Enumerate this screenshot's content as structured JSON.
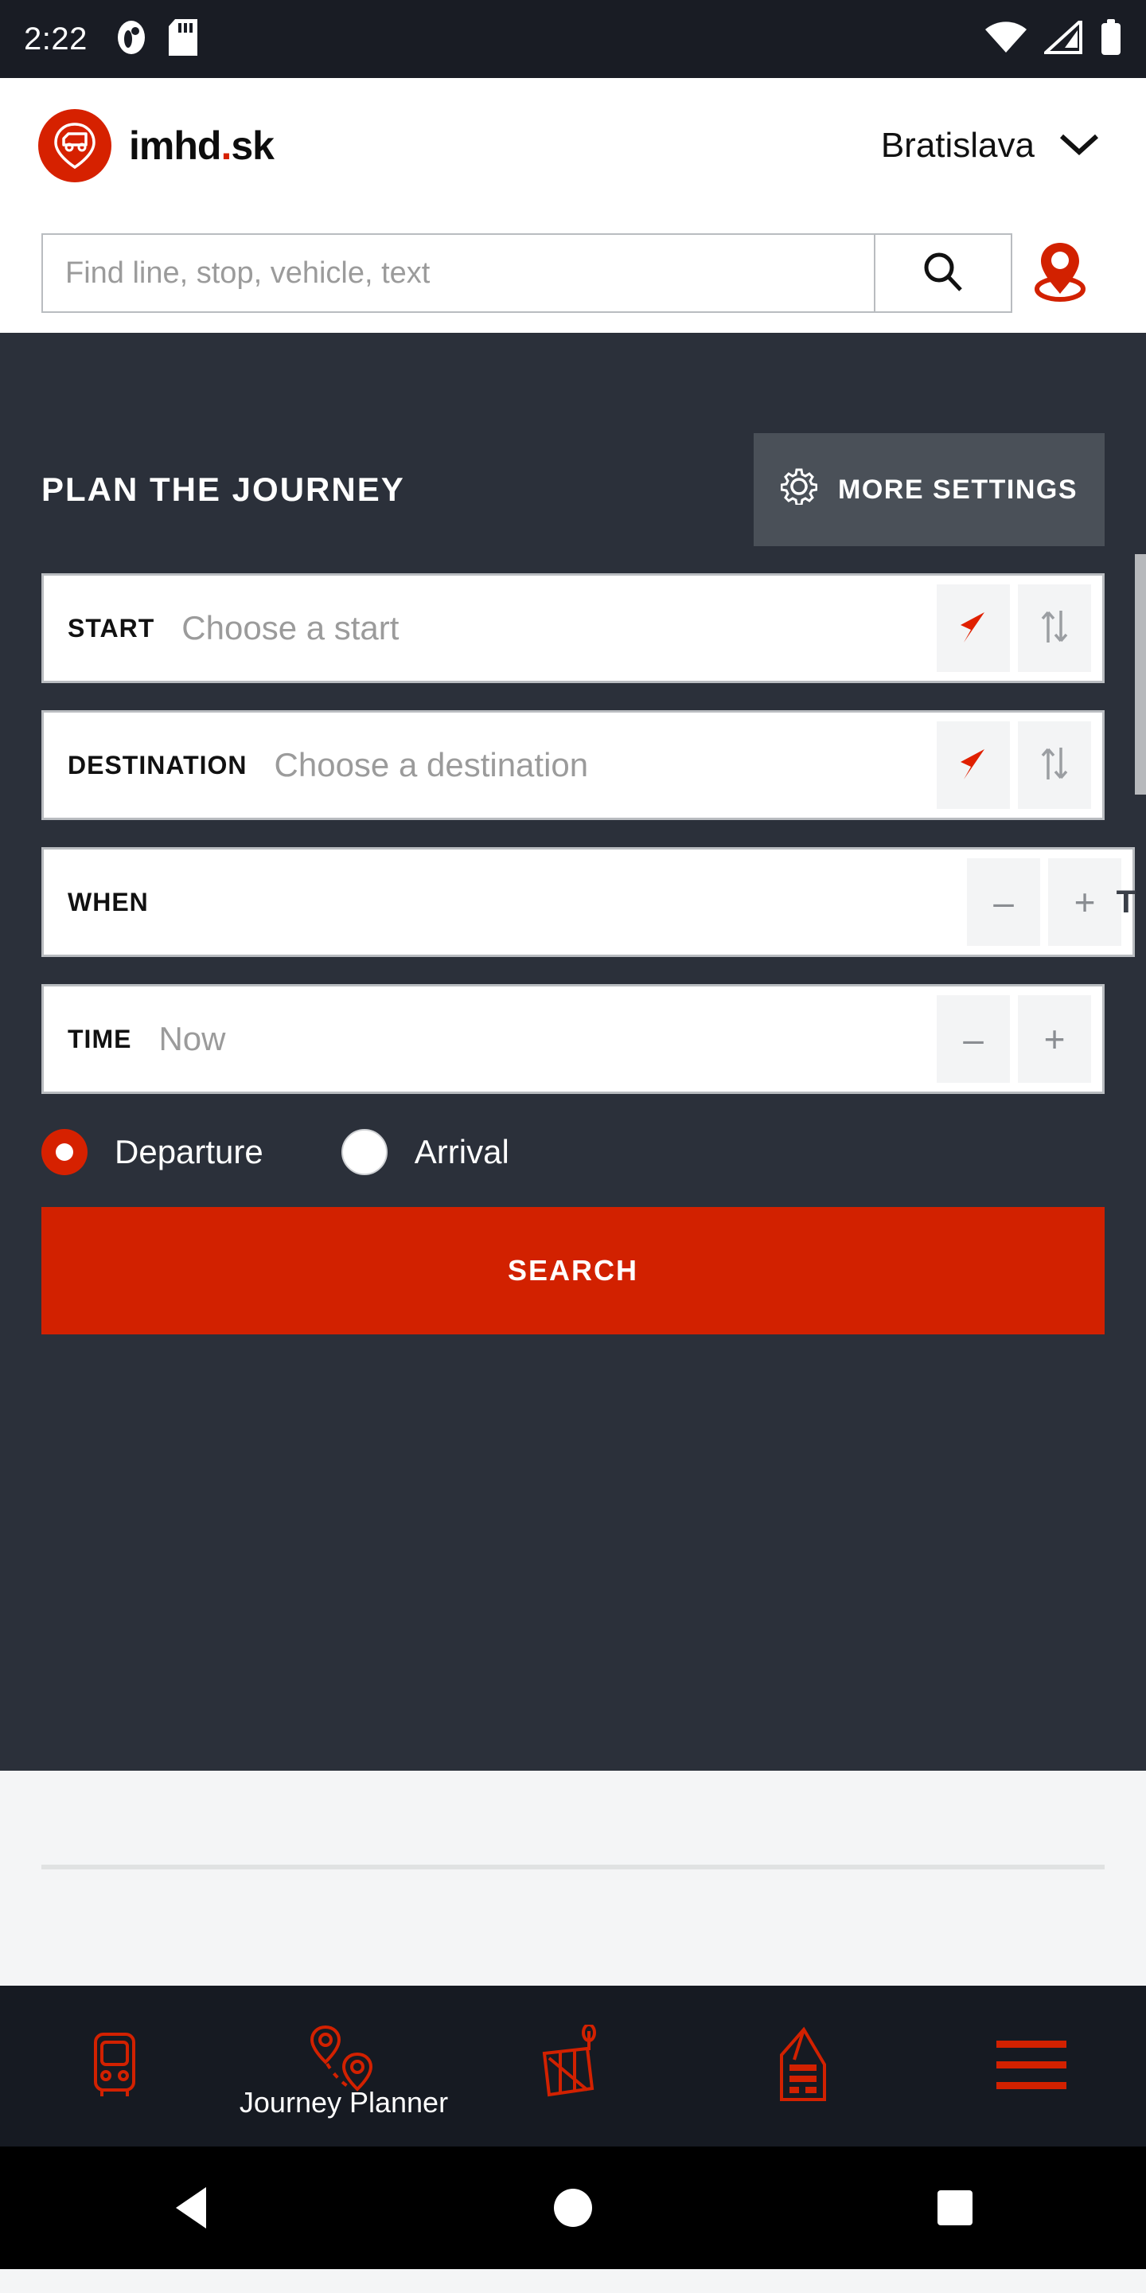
{
  "status_bar": {
    "time": "2:22",
    "left_icons": [
      "notification-icon",
      "sd-card-icon"
    ],
    "right_icons": [
      "wifi-icon",
      "cellular-signal-icon",
      "battery-icon"
    ]
  },
  "header": {
    "logo_text_main": "imhd",
    "logo_dot": ".",
    "logo_text_suffix": "sk",
    "logo_icon": "pin-bus-logo-icon",
    "city": "Bratislava",
    "city_chevron": "chevron-down-icon"
  },
  "search": {
    "placeholder": "Find line, stop, vehicle, text",
    "value": "",
    "search_icon": "magnifier-icon",
    "location_icon": "map-pin-icon"
  },
  "panel": {
    "title": "PLAN THE JOURNEY",
    "more_settings_label": "MORE SETTINGS",
    "more_settings_icon": "gear-icon"
  },
  "form": {
    "start": {
      "label": "START",
      "value": "",
      "placeholder": "Choose a start",
      "locate_icon": "navigation-arrow-icon",
      "swap_icon": "swap-vertical-icon"
    },
    "destination": {
      "label": "DESTINATION",
      "value": "",
      "placeholder": "Choose a destination",
      "locate_icon": "navigation-arrow-icon",
      "swap_icon": "swap-vertical-icon"
    },
    "when": {
      "label": "WHEN",
      "value": "",
      "minus_label": "–",
      "plus_label": "+",
      "clipped_text": "T"
    },
    "time": {
      "label": "TIME",
      "value": "Now",
      "minus_label": "–",
      "plus_label": "+"
    },
    "mode": {
      "departure_label": "Departure",
      "arrival_label": "Arrival",
      "selected": "Departure"
    },
    "submit_label": "SEARCH"
  },
  "bottom_nav": {
    "items": [
      {
        "name": "vehicles",
        "icon": "bus-front-icon",
        "label": ""
      },
      {
        "name": "journey-planner",
        "icon": "route-pins-icon",
        "label": "Journey Planner"
      },
      {
        "name": "map",
        "icon": "map-icon",
        "label": ""
      },
      {
        "name": "news",
        "icon": "news-document-icon",
        "label": ""
      },
      {
        "name": "menu",
        "icon": "hamburger-menu-icon",
        "label": ""
      }
    ]
  },
  "android_nav": {
    "back": "back-triangle-icon",
    "home": "home-circle-icon",
    "recents": "recents-square-icon"
  },
  "colors": {
    "brand_red": "#d22100",
    "panel_dark": "#2b303a",
    "settings_gray": "#4a5058",
    "status_dark": "#191c24",
    "nav_dark": "#161a22"
  }
}
